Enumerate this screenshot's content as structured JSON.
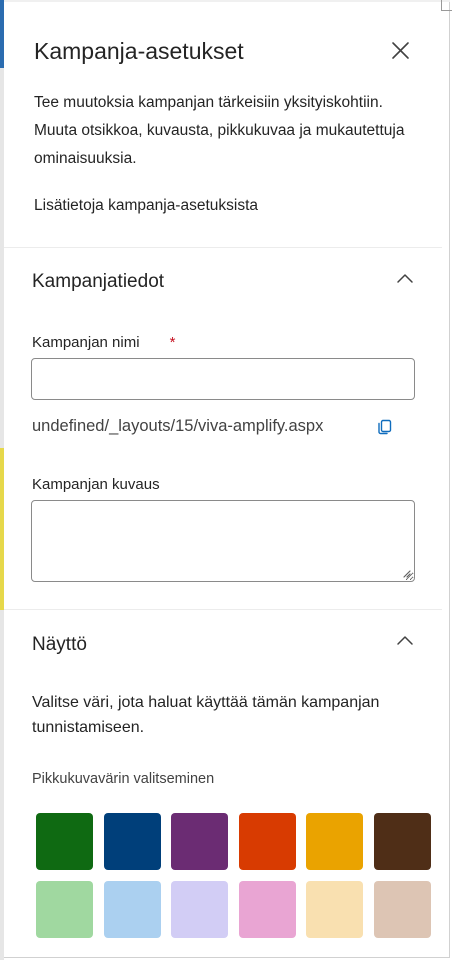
{
  "panel": {
    "title": "Kampanja-asetukset",
    "intro": "Tee muutoksia kampanjan tärkeisiin yksityiskohtiin. Muuta otsikkoa, kuvausta, pikkukuvaa ja mukautettuja ominaisuuksia.",
    "learn_more": "Lisätietoja kampanja-asetuksista"
  },
  "details": {
    "title": "Kampanjatiedot",
    "name_label": "Kampanjan nimi",
    "required_mark": "*",
    "name_value": "",
    "url": "undefined/_layouts/15/viva-amplify.aspx",
    "description_label": "Kampanjan kuvaus",
    "description_value": ""
  },
  "display": {
    "title": "Näyttö",
    "text": "Valitse väri, jota haluat käyttää tämän kampanjan tunnistamiseen.",
    "thumbnail_label": "Pikkukuvavärin valitseminen",
    "colors": [
      "#0f6a12",
      "#003f7a",
      "#6b2c73",
      "#d83b01",
      "#eaa300",
      "#4f2e17",
      "#a0d8a0",
      "#abd0f0",
      "#d2cdf5",
      "#e9a5d3",
      "#f9e0b0",
      "#ddc5b4"
    ]
  },
  "icons": {
    "close": "close-icon",
    "collapse": "chevron-up-icon",
    "copy": "copy-icon",
    "resize": "resize-grip-icon"
  }
}
